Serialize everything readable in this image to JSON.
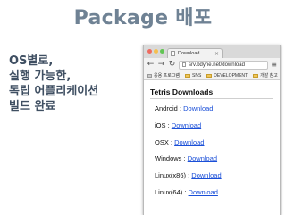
{
  "slide": {
    "title": "Package 배포",
    "description": [
      "OS별로,",
      "실행 가능한,",
      "독립 어플리케이션",
      "빌드 완료"
    ]
  },
  "browser": {
    "tab_title": "Download",
    "url": "srv.bdyne.net/download",
    "bookmarks": [
      "응용 프로그램",
      "SNS",
      "DEVELOPMENT",
      "개발 참고"
    ],
    "page_heading": "Tetris Downloads",
    "downloads": [
      {
        "platform": "Android",
        "separator": " : ",
        "link": "Download"
      },
      {
        "platform": "iOS",
        "separator": " : ",
        "link": "Download"
      },
      {
        "platform": "OSX",
        "separator": " : ",
        "link": "Download"
      },
      {
        "platform": "Windows",
        "separator": " : ",
        "link": "Download"
      },
      {
        "platform": "Linux(x86)",
        "separator": " : ",
        "link": "Download"
      },
      {
        "platform": "Linux(64)",
        "separator": " : ",
        "link": "Download"
      }
    ]
  },
  "colors": {
    "title": "#6f8294",
    "description": "#3f4f62",
    "link": "#1a4fd8"
  }
}
